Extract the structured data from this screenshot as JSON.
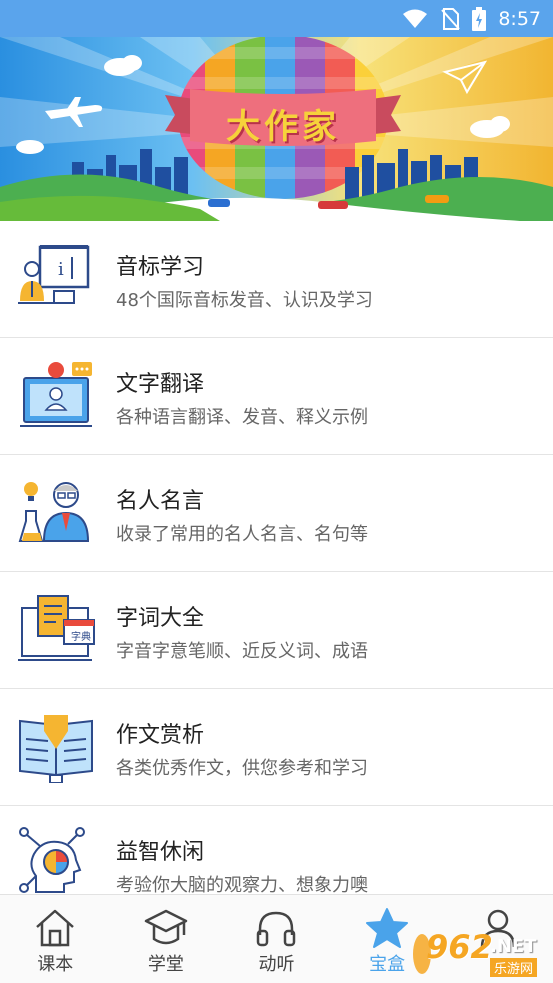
{
  "status_bar": {
    "time": "8:57",
    "icons": [
      "wifi-icon",
      "no-sim-icon",
      "battery-charging-icon"
    ]
  },
  "banner": {
    "title": "大作家"
  },
  "features": [
    {
      "title": "音标学习",
      "desc": "48个国际音标发音、认识及学习",
      "icon": "phonetics-teacher-icon"
    },
    {
      "title": "文字翻译",
      "desc": "各种语言翻译、发音、释义示例",
      "icon": "translation-monitor-icon"
    },
    {
      "title": "名人名言",
      "desc": "收录了常用的名人名言、名句等",
      "icon": "famous-person-icon"
    },
    {
      "title": "字词大全",
      "desc": "字音字意笔顺、近反义词、成语",
      "icon": "dictionary-icon",
      "icon_text": "字典"
    },
    {
      "title": "作文赏析",
      "desc": "各类优秀作文，供您参考和学习",
      "icon": "open-book-icon"
    },
    {
      "title": "益智休闲",
      "desc": "考验你大脑的观察力、想象力噢",
      "icon": "brain-puzzle-icon"
    }
  ],
  "nav": [
    {
      "label": "课本",
      "icon": "home-icon",
      "active": false
    },
    {
      "label": "学堂",
      "icon": "graduation-cap-icon",
      "active": false
    },
    {
      "label": "动听",
      "icon": "headphones-icon",
      "active": false
    },
    {
      "label": "宝盒",
      "icon": "star-icon",
      "active": true
    },
    {
      "label": "",
      "icon": "user-icon",
      "active": false
    }
  ],
  "watermark": {
    "number": "962",
    "suffix": ".NET",
    "caption": "乐游网"
  },
  "colors": {
    "status_bar": "#5aa4ec",
    "accent": "#4aa3ea",
    "banner_ribbon": "#ee6f7d",
    "banner_title": "#f6d23b"
  }
}
